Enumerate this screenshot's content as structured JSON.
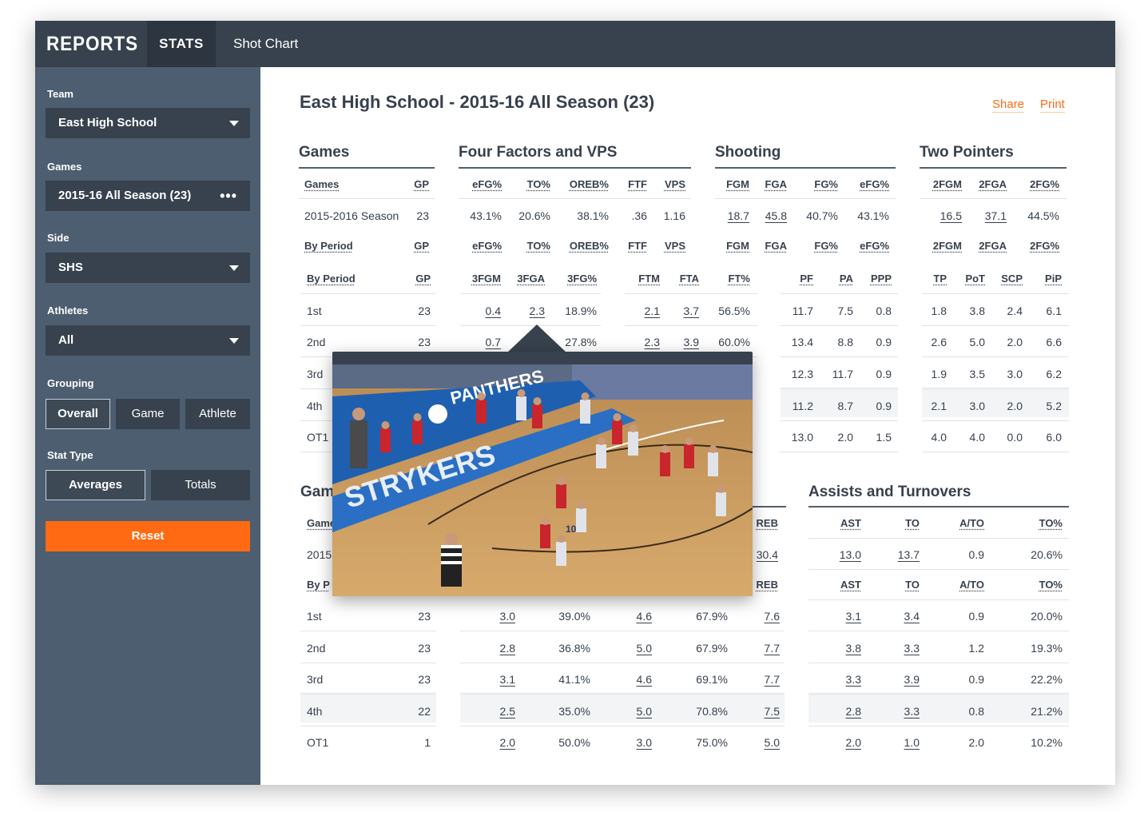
{
  "nav": {
    "brand": "REPORTS",
    "tab_stats": "STATS",
    "tab_shot_chart": "Shot Chart"
  },
  "sidebar": {
    "team_label": "Team",
    "team_value": "East High School",
    "games_label": "Games",
    "games_value": "2015-16 All Season (23)",
    "games_more": "•••",
    "side_label": "Side",
    "side_value": "SHS",
    "athletes_label": "Athletes",
    "athletes_value": "All",
    "grouping_label": "Grouping",
    "grouping_options": [
      "Overall",
      "Game",
      "Athlete"
    ],
    "stat_type_label": "Stat Type",
    "stat_type_options": [
      "Averages",
      "Totals"
    ],
    "reset_label": "Reset"
  },
  "header": {
    "title": "East High School - 2015-16 All Season (23)",
    "share": "Share",
    "print": "Print"
  },
  "sections": {
    "games": "Games",
    "four_factors": "Four Factors and VPS",
    "shooting": "Shooting",
    "two_pointers": "Two Pointers",
    "games_bottom": "Gam",
    "assists": "Assists and Turnovers"
  },
  "top_table": {
    "h1": [
      "Games",
      "GP",
      "eFG%",
      "TO%",
      "OREB%",
      "FTF",
      "VPS",
      "FGM",
      "FGA",
      "FG%",
      "eFG%",
      "2FGM",
      "2FGA",
      "2FG%"
    ],
    "season": [
      "2015-2016 Season",
      "23",
      "43.1%",
      "20.6%",
      "38.1%",
      ".36",
      "1.16",
      "18.7",
      "45.8",
      "40.7%",
      "43.1%",
      "16.5",
      "37.1",
      "44.5%"
    ],
    "h2": [
      "By Period",
      "GP",
      "eFG%",
      "TO%",
      "OREB%",
      "FTF",
      "VPS",
      "FGM",
      "FGA",
      "FG%",
      "eFG%",
      "2FGM",
      "2FGA",
      "2FG%"
    ]
  },
  "period_table": {
    "h": [
      "By Period",
      "GP",
      "3FGM",
      "3FGA",
      "3FG%",
      "FTM",
      "FTA",
      "FT%",
      "PF",
      "PA",
      "PPP",
      "TP",
      "PoT",
      "SCP",
      "PiP"
    ],
    "rows": [
      [
        "1st",
        "23",
        "0.4",
        "2.3",
        "18.9%",
        "2.1",
        "3.7",
        "56.5%",
        "11.7",
        "7.5",
        "0.8",
        "1.8",
        "3.8",
        "2.4",
        "6.1"
      ],
      [
        "2nd",
        "23",
        "0.7",
        "",
        "27.8%",
        "2.3",
        "3.9",
        "60.0%",
        "13.4",
        "8.8",
        "0.9",
        "2.6",
        "5.0",
        "2.0",
        "6.6"
      ],
      [
        "3rd",
        "",
        "",
        "",
        "",
        "",
        "",
        "",
        "12.3",
        "11.7",
        "0.9",
        "1.9",
        "3.5",
        "3.0",
        "6.2"
      ],
      [
        "4th",
        "",
        "",
        "",
        "",
        "",
        "",
        "",
        "11.2",
        "8.7",
        "0.9",
        "2.1",
        "3.0",
        "2.0",
        "5.2"
      ],
      [
        "OT1",
        "",
        "",
        "",
        "",
        "",
        "",
        "",
        "13.0",
        "2.0",
        "1.5",
        "4.0",
        "4.0",
        "0.0",
        "6.0"
      ]
    ]
  },
  "bottom_table": {
    "games_hdr": "Game",
    "season_label": "2015",
    "by_period_hdr": "By P",
    "reb_hdr": "REB",
    "season_reb": "30.4",
    "reb_hdr2": "REB",
    "assist_hdr": [
      "AST",
      "TO",
      "A/TO",
      "TO%"
    ],
    "assist_season": [
      "13.0",
      "13.7",
      "0.9",
      "20.6%"
    ],
    "rows": [
      [
        "1st",
        "23",
        "3.0",
        "39.0%",
        "4.6",
        "67.9%",
        "7.6",
        "3.1",
        "3.4",
        "0.9",
        "20.0%"
      ],
      [
        "2nd",
        "23",
        "2.8",
        "36.8%",
        "5.0",
        "67.9%",
        "7.7",
        "3.8",
        "3.3",
        "1.2",
        "19.3%"
      ],
      [
        "3rd",
        "23",
        "3.1",
        "41.1%",
        "4.6",
        "69.1%",
        "7.7",
        "3.3",
        "3.9",
        "0.9",
        "22.2%"
      ],
      [
        "4th",
        "22",
        "2.5",
        "35.0%",
        "5.0",
        "70.8%",
        "7.5",
        "2.8",
        "3.3",
        "0.8",
        "21.2%"
      ],
      [
        "OT1",
        "1",
        "2.0",
        "50.0%",
        "3.0",
        "75.0%",
        "5.0",
        "2.0",
        "1.0",
        "2.0",
        "10.2%"
      ]
    ]
  },
  "video": {
    "banner_text": "STRYKERS",
    "wall_text": "PANTHERS",
    "jersey_number": "10",
    "colors": {
      "court": "#c99a5c",
      "wall": "#1f5fb0",
      "home": "#e0e4ea",
      "away": "#c9252c"
    }
  }
}
